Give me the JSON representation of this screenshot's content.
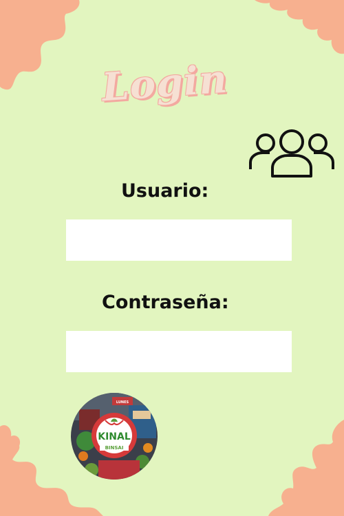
{
  "login": {
    "title": "Login",
    "username_label": "Usuario:",
    "username_value": "",
    "password_label": "Contraseña:",
    "password_value": ""
  },
  "logo": {
    "brand_text": "KINAL",
    "sub_text": "BINSAI",
    "ribbon_text": "LUNES"
  },
  "icons": {
    "users": "users-group-icon"
  },
  "colors": {
    "background": "#e2f5bf",
    "splash": "#f7b08f",
    "title_fill": "#f6e0d3",
    "title_outline": "#f3a9a0",
    "text": "#111111",
    "field": "#ffffff"
  }
}
